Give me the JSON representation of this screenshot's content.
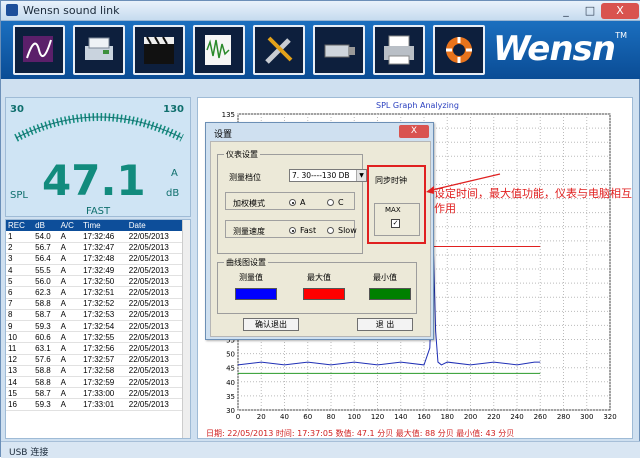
{
  "window": {
    "title": "Wensn sound link",
    "minimize": "_",
    "maximize": "□",
    "close": "X"
  },
  "toolbar": {
    "tools": [
      {
        "name": "curve-tool-icon"
      },
      {
        "name": "disk-save-icon"
      },
      {
        "name": "clapperboard-icon"
      },
      {
        "name": "waveform-icon"
      },
      {
        "name": "wrench-icon"
      },
      {
        "name": "usb-drive-icon"
      },
      {
        "name": "printer-icon"
      },
      {
        "name": "lifebuoy-icon"
      }
    ],
    "brand": "Wensn",
    "tm": "TM"
  },
  "meter": {
    "scale_min": "30",
    "scale_max": "130",
    "value": "47.1",
    "spl_label": "SPL",
    "unit_a": "A",
    "unit_db": "dB",
    "speed": "FAST"
  },
  "table": {
    "headers": [
      "REC",
      "dB",
      "A/C",
      "Time",
      "Date"
    ],
    "rows": [
      [
        "1",
        "54.0",
        "A",
        "17:32:46",
        "22/05/2013"
      ],
      [
        "2",
        "56.7",
        "A",
        "17:32:47",
        "22/05/2013"
      ],
      [
        "3",
        "56.4",
        "A",
        "17:32:48",
        "22/05/2013"
      ],
      [
        "4",
        "55.5",
        "A",
        "17:32:49",
        "22/05/2013"
      ],
      [
        "5",
        "56.0",
        "A",
        "17:32:50",
        "22/05/2013"
      ],
      [
        "6",
        "62.3",
        "A",
        "17:32:51",
        "22/05/2013"
      ],
      [
        "7",
        "58.8",
        "A",
        "17:32:52",
        "22/05/2013"
      ],
      [
        "8",
        "58.7",
        "A",
        "17:32:53",
        "22/05/2013"
      ],
      [
        "9",
        "59.3",
        "A",
        "17:32:54",
        "22/05/2013"
      ],
      [
        "10",
        "60.6",
        "A",
        "17:32:55",
        "22/05/2013"
      ],
      [
        "11",
        "63.1",
        "A",
        "17:32:56",
        "22/05/2013"
      ],
      [
        "12",
        "57.6",
        "A",
        "17:32:57",
        "22/05/2013"
      ],
      [
        "13",
        "58.8",
        "A",
        "17:32:58",
        "22/05/2013"
      ],
      [
        "14",
        "58.8",
        "A",
        "17:32:59",
        "22/05/2013"
      ],
      [
        "15",
        "58.7",
        "A",
        "17:33:00",
        "22/05/2013"
      ],
      [
        "16",
        "59.3",
        "A",
        "17:33:01",
        "22/05/2013"
      ]
    ]
  },
  "graph": {
    "title": "SPL Graph Analyzing",
    "y_ticks": [
      "135",
      "130",
      "125",
      "120",
      "115",
      "110",
      "105",
      "100",
      "95",
      "90",
      "85",
      "80",
      "75",
      "70",
      "65",
      "60",
      "55",
      "50",
      "45",
      "40",
      "35",
      "30"
    ],
    "x_ticks": [
      "0",
      "20",
      "40",
      "60",
      "80",
      "100",
      "120",
      "140",
      "160",
      "180",
      "200",
      "220",
      "240",
      "260",
      "280",
      "300",
      "320"
    ],
    "status": "日期: 22/05/2013  时间: 17:37:05  数值: 47.1 分贝  最大值: 88 分贝  最小值: 43 分贝"
  },
  "chart_data": {
    "type": "line",
    "title": "SPL Graph Analyzing",
    "xlabel": "",
    "ylabel": "",
    "xlim": [
      0,
      320
    ],
    "ylim": [
      30,
      135
    ],
    "grid": true,
    "series": [
      {
        "color": "#1f2fb5",
        "x": [
          0,
          20,
          40,
          60,
          80,
          100,
          120,
          140,
          160,
          165,
          168,
          170,
          172,
          175,
          180,
          200,
          220,
          240,
          255,
          260
        ],
        "y": [
          46,
          47,
          46,
          47,
          46,
          47,
          46,
          47,
          46,
          52,
          88,
          58,
          47,
          46,
          47,
          46,
          47,
          46,
          47,
          47
        ]
      },
      {
        "color": "#e02020",
        "x": [
          0,
          165,
          168,
          260
        ],
        "y": [
          88,
          88,
          88,
          88
        ]
      },
      {
        "color": "#2a9a2a",
        "x": [
          0,
          165,
          168,
          260
        ],
        "y": [
          43,
          43,
          43,
          43
        ]
      }
    ]
  },
  "dialog": {
    "title": "设置",
    "close": "X",
    "meter_group": "仪表设置",
    "range_label": "测量档位",
    "range_value": "7. 30----130 DB",
    "weight_label": "加权模式",
    "weight_a": "A",
    "weight_c": "C",
    "speed_label": "测量速度",
    "speed_fast": "Fast",
    "speed_slow": "Slow",
    "sync_label": "同步时钟",
    "max_label": "MAX",
    "max_check": "✓",
    "curve_group": "曲线图设置",
    "measured_label": "测量值",
    "max_value_label": "最大值",
    "min_value_label": "最小值",
    "measured_color": "#0000ff",
    "max_color": "#ff0000",
    "min_color": "#008000",
    "confirm_button": "确认退出",
    "exit_button": "退  出"
  },
  "annotation": "设定时间，最大值功能，仪表与电脑相互作用",
  "statusbar": {
    "text": "USB 连接"
  }
}
